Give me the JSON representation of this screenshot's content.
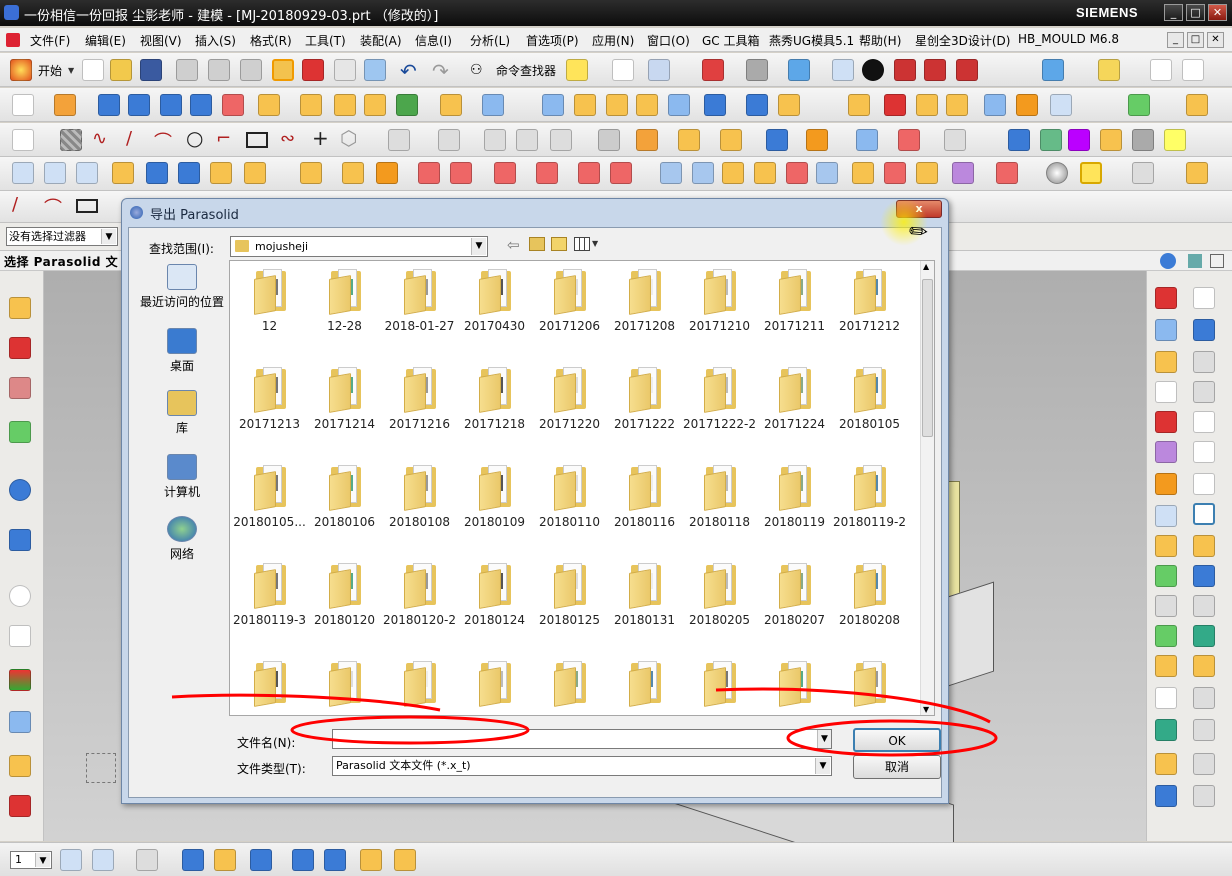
{
  "window": {
    "title": "一份相信一份回报  尘影老师 - 建模 - [MJ-20180929-03.prt （修改的）]",
    "brand": "SIEMENS",
    "btn_min": "_",
    "btn_max": "□",
    "btn_close": "✕"
  },
  "menubar": {
    "items": [
      "文件(F)",
      "编辑(E)",
      "视图(V)",
      "插入(S)",
      "格式(R)",
      "工具(T)",
      "装配(A)",
      "信息(I)",
      "分析(L)",
      "首选项(P)",
      "应用(N)",
      "窗口(O)",
      "GC 工具箱",
      "燕秀UG模具5.1",
      "帮助(H)",
      "星创全3D设计(D)",
      "HB_MOULD M6.8"
    ]
  },
  "toolbar": {
    "start_label": "开始",
    "command_finder_label": "命令查找器"
  },
  "selection": {
    "filter_value": "没有选择过滤器",
    "prompt": "选择 Parasolid 文"
  },
  "dialog": {
    "title": "导出 Parasolid",
    "close_label": "x",
    "look_in_label": "查找范围(I):",
    "look_in_value": "mojusheji",
    "places": [
      "最近访问的位置",
      "桌面",
      "库",
      "计算机",
      "网络"
    ],
    "folders": [
      "12",
      "12-28",
      "2018-01-27",
      "20170430",
      "20171206",
      "20171208",
      "20171210",
      "20171211",
      "20171212",
      "20171213",
      "20171214",
      "20171216",
      "20171218",
      "20171220",
      "20171222",
      "20171222-2",
      "20171224",
      "20180105",
      "20180105...",
      "20180106",
      "20180108",
      "20180109",
      "20180110",
      "20180116",
      "20180118",
      "20180119",
      "20180119-2",
      "20180119-3",
      "20180120",
      "20180120-2",
      "20180124",
      "20180125",
      "20180131",
      "20180205",
      "20180207",
      "20180208"
    ],
    "file_name_label": "文件名(N):",
    "file_name_value": "",
    "file_type_label": "文件类型(T):",
    "file_type_value": "Parasolid 文本文件 (*.x_t)",
    "ok_label": "OK",
    "cancel_label": "取消"
  },
  "statusbar": {
    "layer_value": "1"
  },
  "colors": {
    "annotation_red": "#ff0000",
    "dialog_frame": "#c8d7ea",
    "folder_yellow": "#e7c45c"
  }
}
